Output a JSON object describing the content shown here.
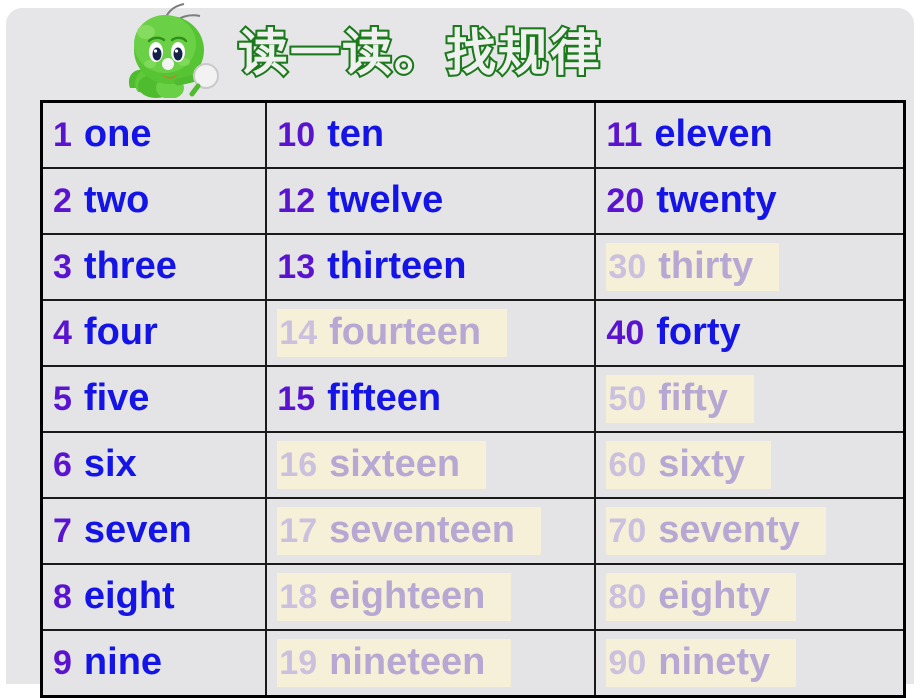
{
  "slide": {
    "title": "读一读。找规律",
    "mascot_name": "green-caterpillar-mascot",
    "colors": {
      "title_stroke": "#1b7a1b",
      "title_fill": "#f0f0f0",
      "number": "#5a14cf",
      "word": "#1414e6",
      "faded_number": "#cbc0dd",
      "faded_word": "#b6a8d2",
      "cell_bg": "#e4e4e6",
      "highlight_bg": "#f6f0d9",
      "border": "#1a1a1a"
    }
  },
  "table": {
    "rows": [
      {
        "c1": {
          "num": "1",
          "word": "one",
          "faded": false
        },
        "c2": {
          "num": "10",
          "word": "ten",
          "faded": false
        },
        "c3": {
          "num": "11",
          "word": "eleven",
          "faded": false
        }
      },
      {
        "c1": {
          "num": "2",
          "word": "two",
          "faded": false
        },
        "c2": {
          "num": "12",
          "word": "twelve",
          "faded": false
        },
        "c3": {
          "num": "20",
          "word": "twenty",
          "faded": false
        }
      },
      {
        "c1": {
          "num": "3",
          "word": "three",
          "faded": false
        },
        "c2": {
          "num": "13",
          "word": "thirteen",
          "faded": false
        },
        "c3": {
          "num": "30",
          "word": "thirty",
          "faded": true
        }
      },
      {
        "c1": {
          "num": "4",
          "word": "four",
          "faded": false
        },
        "c2": {
          "num": "14",
          "word": "fourteen",
          "faded": true
        },
        "c3": {
          "num": "40",
          "word": "forty",
          "faded": false
        }
      },
      {
        "c1": {
          "num": "5",
          "word": "five",
          "faded": false
        },
        "c2": {
          "num": "15",
          "word": "fifteen",
          "faded": false
        },
        "c3": {
          "num": "50",
          "word": "fifty",
          "faded": true
        }
      },
      {
        "c1": {
          "num": "6",
          "word": "six",
          "faded": false
        },
        "c2": {
          "num": "16",
          "word": "sixteen",
          "faded": true
        },
        "c3": {
          "num": "60",
          "word": "sixty",
          "faded": true
        }
      },
      {
        "c1": {
          "num": "7",
          "word": "seven",
          "faded": false
        },
        "c2": {
          "num": "17",
          "word": "seventeen",
          "faded": true
        },
        "c3": {
          "num": "70",
          "word": "seventy",
          "faded": true
        }
      },
      {
        "c1": {
          "num": "8",
          "word": "eight",
          "faded": false
        },
        "c2": {
          "num": "18",
          "word": "eighteen",
          "faded": true
        },
        "c3": {
          "num": "80",
          "word": "eighty",
          "faded": true
        }
      },
      {
        "c1": {
          "num": "9",
          "word": "nine",
          "faded": false
        },
        "c2": {
          "num": "19",
          "word": "nineteen",
          "faded": true
        },
        "c3": {
          "num": "90",
          "word": "ninety",
          "faded": true
        }
      }
    ]
  }
}
